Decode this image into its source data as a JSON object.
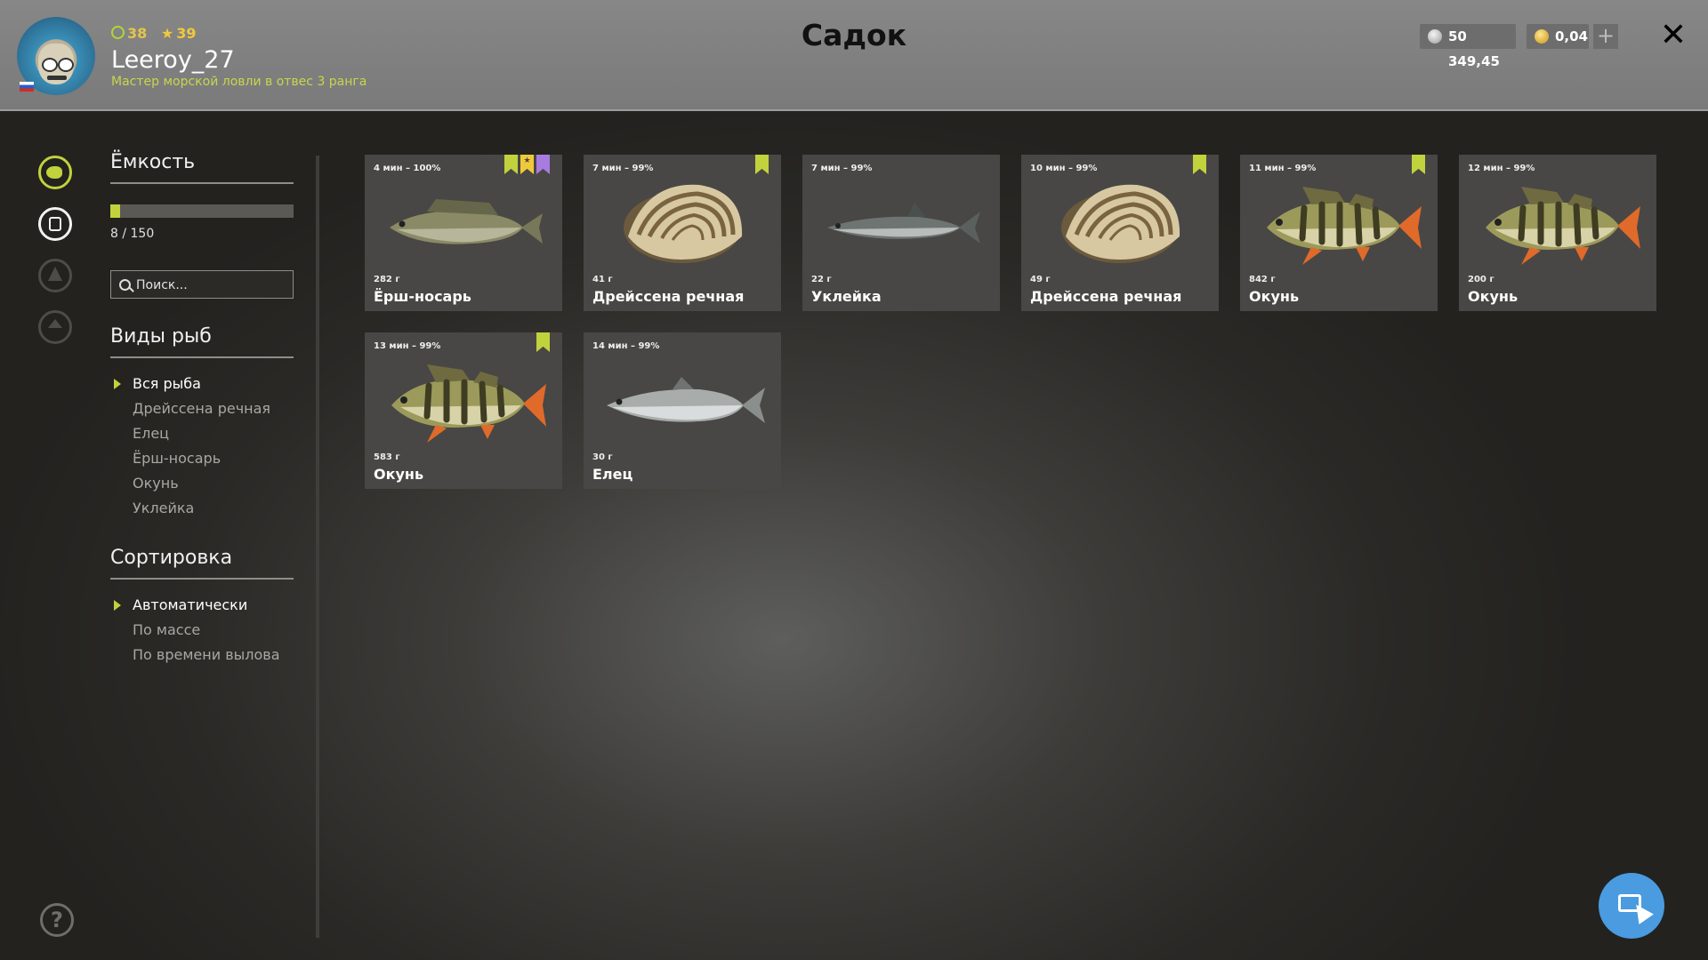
{
  "header": {
    "level": "38",
    "stars": "39",
    "username": "Leeroy_27",
    "rank": "Мастер морской ловли в отвес 3 ранга",
    "title": "Садок",
    "silver": "50 349,45",
    "gold": "0,04",
    "plus_label": "+",
    "close_label": "✕"
  },
  "capacity": {
    "label": "Ёмкость",
    "text": "8 / 150",
    "fill": 0.053
  },
  "search": {
    "placeholder": "Поиск..."
  },
  "species": {
    "label": "Виды рыб",
    "items": [
      "Вся рыба",
      "Дрейссена речная",
      "Елец",
      "Ёрш-носарь",
      "Окунь",
      "Уклейка"
    ],
    "active": 0
  },
  "sorting": {
    "label": "Сортировка",
    "items": [
      "Автоматически",
      "По массе",
      "По времени вылова"
    ],
    "active": 0
  },
  "catch": [
    {
      "time": "4 мин – 100%",
      "weight": "282 г",
      "name": "Ёрш-носарь",
      "kind": "ruffe",
      "badges": [
        "green",
        "yellow",
        "purple"
      ]
    },
    {
      "time": "7 мин – 99%",
      "weight": "41 г",
      "name": "Дрейссена речная",
      "kind": "mussel",
      "badges": [
        "green"
      ]
    },
    {
      "time": "7 мин – 99%",
      "weight": "22 г",
      "name": "Уклейка",
      "kind": "bleak",
      "badges": []
    },
    {
      "time": "10 мин – 99%",
      "weight": "49 г",
      "name": "Дрейссена речная",
      "kind": "mussel",
      "badges": [
        "green"
      ]
    },
    {
      "time": "11 мин – 99%",
      "weight": "842 г",
      "name": "Окунь",
      "kind": "perch",
      "badges": [
        "green"
      ]
    },
    {
      "time": "12 мин – 99%",
      "weight": "200 г",
      "name": "Окунь",
      "kind": "perch",
      "badges": []
    },
    {
      "time": "13 мин – 99%",
      "weight": "583 г",
      "name": "Окунь",
      "kind": "perch",
      "badges": [
        "green"
      ]
    },
    {
      "time": "14 мин – 99%",
      "weight": "30 г",
      "name": "Елец",
      "kind": "dace",
      "badges": []
    }
  ],
  "colors": {
    "accent": "#c2d23c",
    "badge_green": "#c2d23c",
    "badge_yellow": "#f0c93a",
    "badge_purple": "#a87be0",
    "card_bg": "#484745",
    "cursor_button": "#4a9be0"
  },
  "icons": {
    "rail": [
      "fish-icon",
      "keepnet-icon",
      "rank-up-icon",
      "home-icon"
    ],
    "help": "help-icon",
    "cursor": "cursor-mode-icon"
  }
}
